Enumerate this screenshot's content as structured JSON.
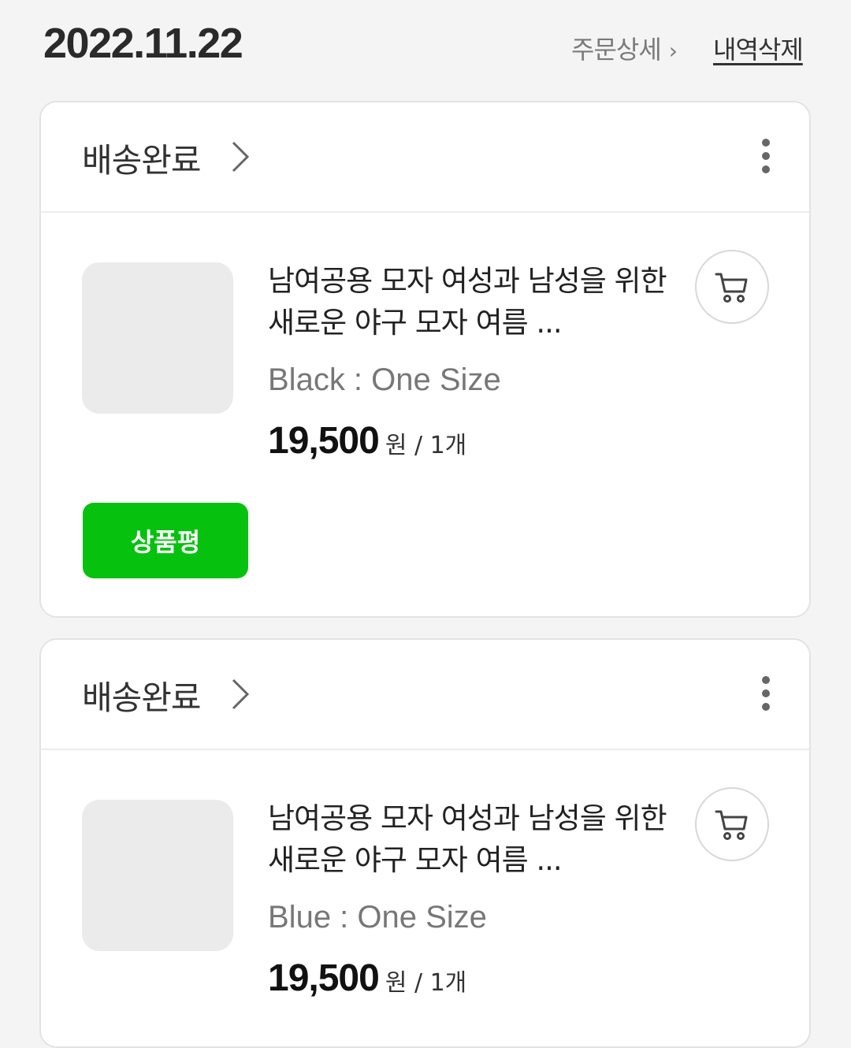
{
  "header": {
    "date": "2022.11.22",
    "order_detail_label": "주문상세",
    "order_detail_chevron": "›",
    "delete_label": "내역삭제"
  },
  "orders": [
    {
      "status": "배송완료",
      "product_title": "남여공용 모자 여성과 남성을 위한 새로운 야구 모자 여름 ...",
      "option": "Black : One Size",
      "price": "19,500",
      "price_unit": "원 / 1개",
      "review_button": "상품평"
    },
    {
      "status": "배송완료",
      "product_title": "남여공용 모자 여성과 남성을 위한 새로운 야구 모자 여름 ...",
      "option": "Blue : One Size",
      "price": "19,500",
      "price_unit": "원 / 1개"
    }
  ],
  "icons": {
    "status_chevron": "chevron-right-icon",
    "more": "more-vertical-icon",
    "cart": "cart-icon"
  },
  "colors": {
    "review_button_bg": "#06c20f",
    "background": "#f4f4f4"
  }
}
